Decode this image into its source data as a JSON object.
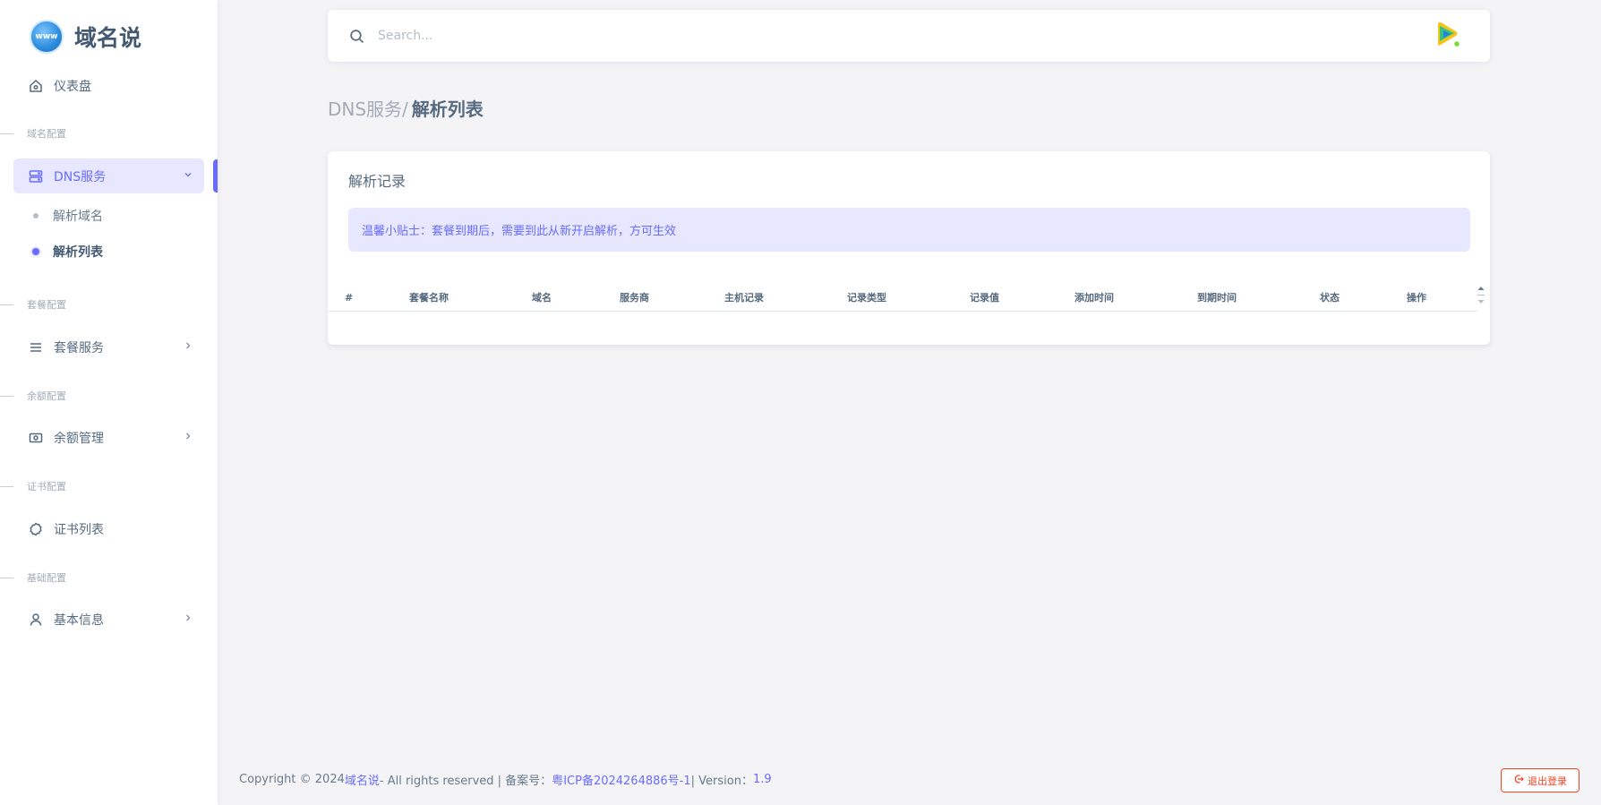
{
  "brand": {
    "name": "域名说",
    "logo_text": "www"
  },
  "sidebar": {
    "dashboard": "仪表盘",
    "sections": {
      "domain": "域名配置",
      "package": "套餐配置",
      "balance": "余额配置",
      "cert": "证书配置",
      "basic": "基础配置"
    },
    "dns_service": "DNS服务",
    "dns_sub": [
      "解析域名",
      "解析列表"
    ],
    "package_service": "套餐服务",
    "balance_manage": "余额管理",
    "cert_list": "证书列表",
    "basic_info": "基本信息"
  },
  "search": {
    "placeholder": "Search..."
  },
  "breadcrumb": {
    "parent": "DNS服务/",
    "current": "解析列表"
  },
  "card": {
    "title": "解析记录",
    "alert": "温馨小贴士：套餐到期后，需要到此从新开启解析，方可生效"
  },
  "table": {
    "headers": [
      "#",
      "套餐名称",
      "域名",
      "服务商",
      "主机记录",
      "记录类型",
      "记录值",
      "添加时间",
      "到期时间",
      "状态",
      "操作"
    ]
  },
  "footer": {
    "copyright_prefix": "Copyright © 2024 ",
    "site_name": "域名说",
    "rights": " - All rights reserved | 备案号：",
    "icp": "粤ICP备2024264886号-1",
    "version_label": " | Version：",
    "version": "1.9"
  },
  "logout_label": "退出登录",
  "colors": {
    "primary": "#696cff",
    "danger": "#ff3e1d",
    "text": "#566a7f"
  }
}
